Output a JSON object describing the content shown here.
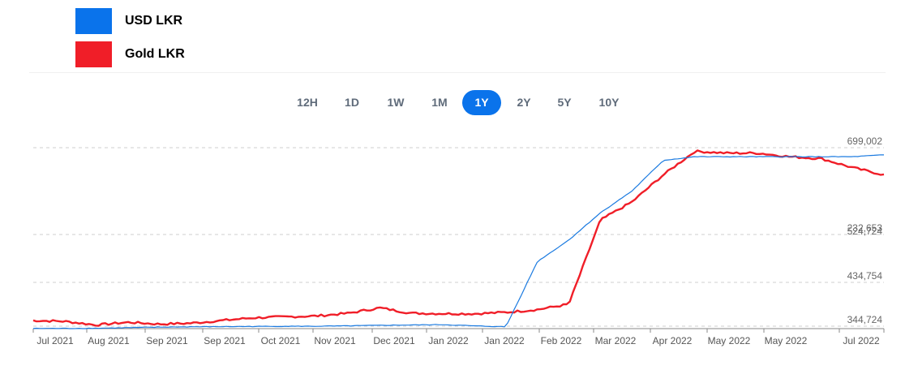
{
  "legend": [
    {
      "label": "USD LKR",
      "color": "#0a73eb"
    },
    {
      "label": "Gold LKR",
      "color": "#f01e28"
    }
  ],
  "ranges": [
    "12H",
    "1D",
    "1W",
    "1M",
    "1Y",
    "2Y",
    "5Y",
    "10Y"
  ],
  "active_range": "1Y",
  "chart_data": {
    "type": "line",
    "x": [
      "Jul 2021",
      "Aug 2021",
      "Sep 2021",
      "Sep 2021",
      "Oct 2021",
      "Nov 2021",
      "Dec 2021",
      "Jan 2022",
      "Jan 2022",
      "Feb 2022",
      "Mar 2022",
      "Apr 2022",
      "May 2022",
      "May 2022",
      "Jul 2022"
    ],
    "y_gridlines": [
      {
        "left": "699,002",
        "right": "699,002"
      },
      {
        "left": "232,653",
        "right": "524,724"
      },
      {
        "left": "434,754",
        "right": "434,754"
      },
      {
        "left": "344,724",
        "right": "344,724"
      }
    ],
    "series": [
      {
        "name": "USD LKR",
        "color": "#1a7ae0",
        "values": [
          0.1,
          0.1,
          0.2,
          0.5,
          0.8,
          1.0,
          1.1,
          1.2,
          1.3,
          1.3,
          1.5,
          1.8,
          2.0,
          2.2,
          1.5,
          1.0,
          37,
          49,
          64,
          76,
          93,
          95,
          95,
          95,
          95,
          95,
          95,
          96
        ]
      },
      {
        "name": "Gold LKR",
        "color": "#f01e28",
        "values": [
          4.5,
          4.0,
          2.0,
          3.5,
          2.5,
          3.0,
          4.5,
          6.0,
          6.5,
          7.0,
          8.5,
          11.5,
          8.5,
          8.3,
          8.2,
          9.0,
          10.5,
          13.5,
          60,
          70,
          85,
          98,
          97,
          97,
          95,
          94,
          89,
          85
        ]
      }
    ],
    "grid": true
  }
}
